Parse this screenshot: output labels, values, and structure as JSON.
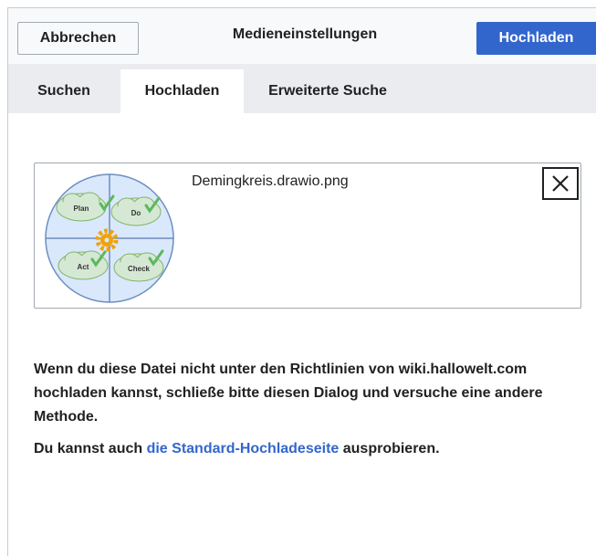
{
  "header": {
    "cancel_label": "Abbrechen",
    "title": "Medieneinstellungen",
    "upload_label": "Hochladen"
  },
  "tabs": [
    {
      "label": "Suchen",
      "active": false
    },
    {
      "label": "Hochladen",
      "active": true
    },
    {
      "label": "Erweiterte Suche",
      "active": false
    }
  ],
  "file": {
    "name": "Demingkreis.drawio.png",
    "thumbnail": {
      "quadrant_labels": [
        "Plan",
        "Do",
        "Act",
        "Check"
      ],
      "circle_color": "#dae8fc",
      "circle_stroke": "#6c8ebf",
      "cloud_color": "#d5e8d4",
      "cloud_stroke": "#82b366",
      "check_color": "#5cb85c",
      "gear_color": "#f0a30a"
    },
    "remove_icon": "close-icon"
  },
  "info": {
    "text": "Wenn du diese Datei nicht unter den Richtlinien von wiki.hallowelt.com hochladen kannst, schließe bitte diesen Dialog und versuche eine andere Methode.",
    "alt_prefix": "Du kannst auch ",
    "alt_link": "die Standard-Hochladeseite",
    "alt_suffix": " ausprobieren."
  },
  "colors": {
    "accent": "#3366cc",
    "link": "#36c",
    "header_bg": "#f8f9fa",
    "tabs_bg": "#eaecf0"
  }
}
